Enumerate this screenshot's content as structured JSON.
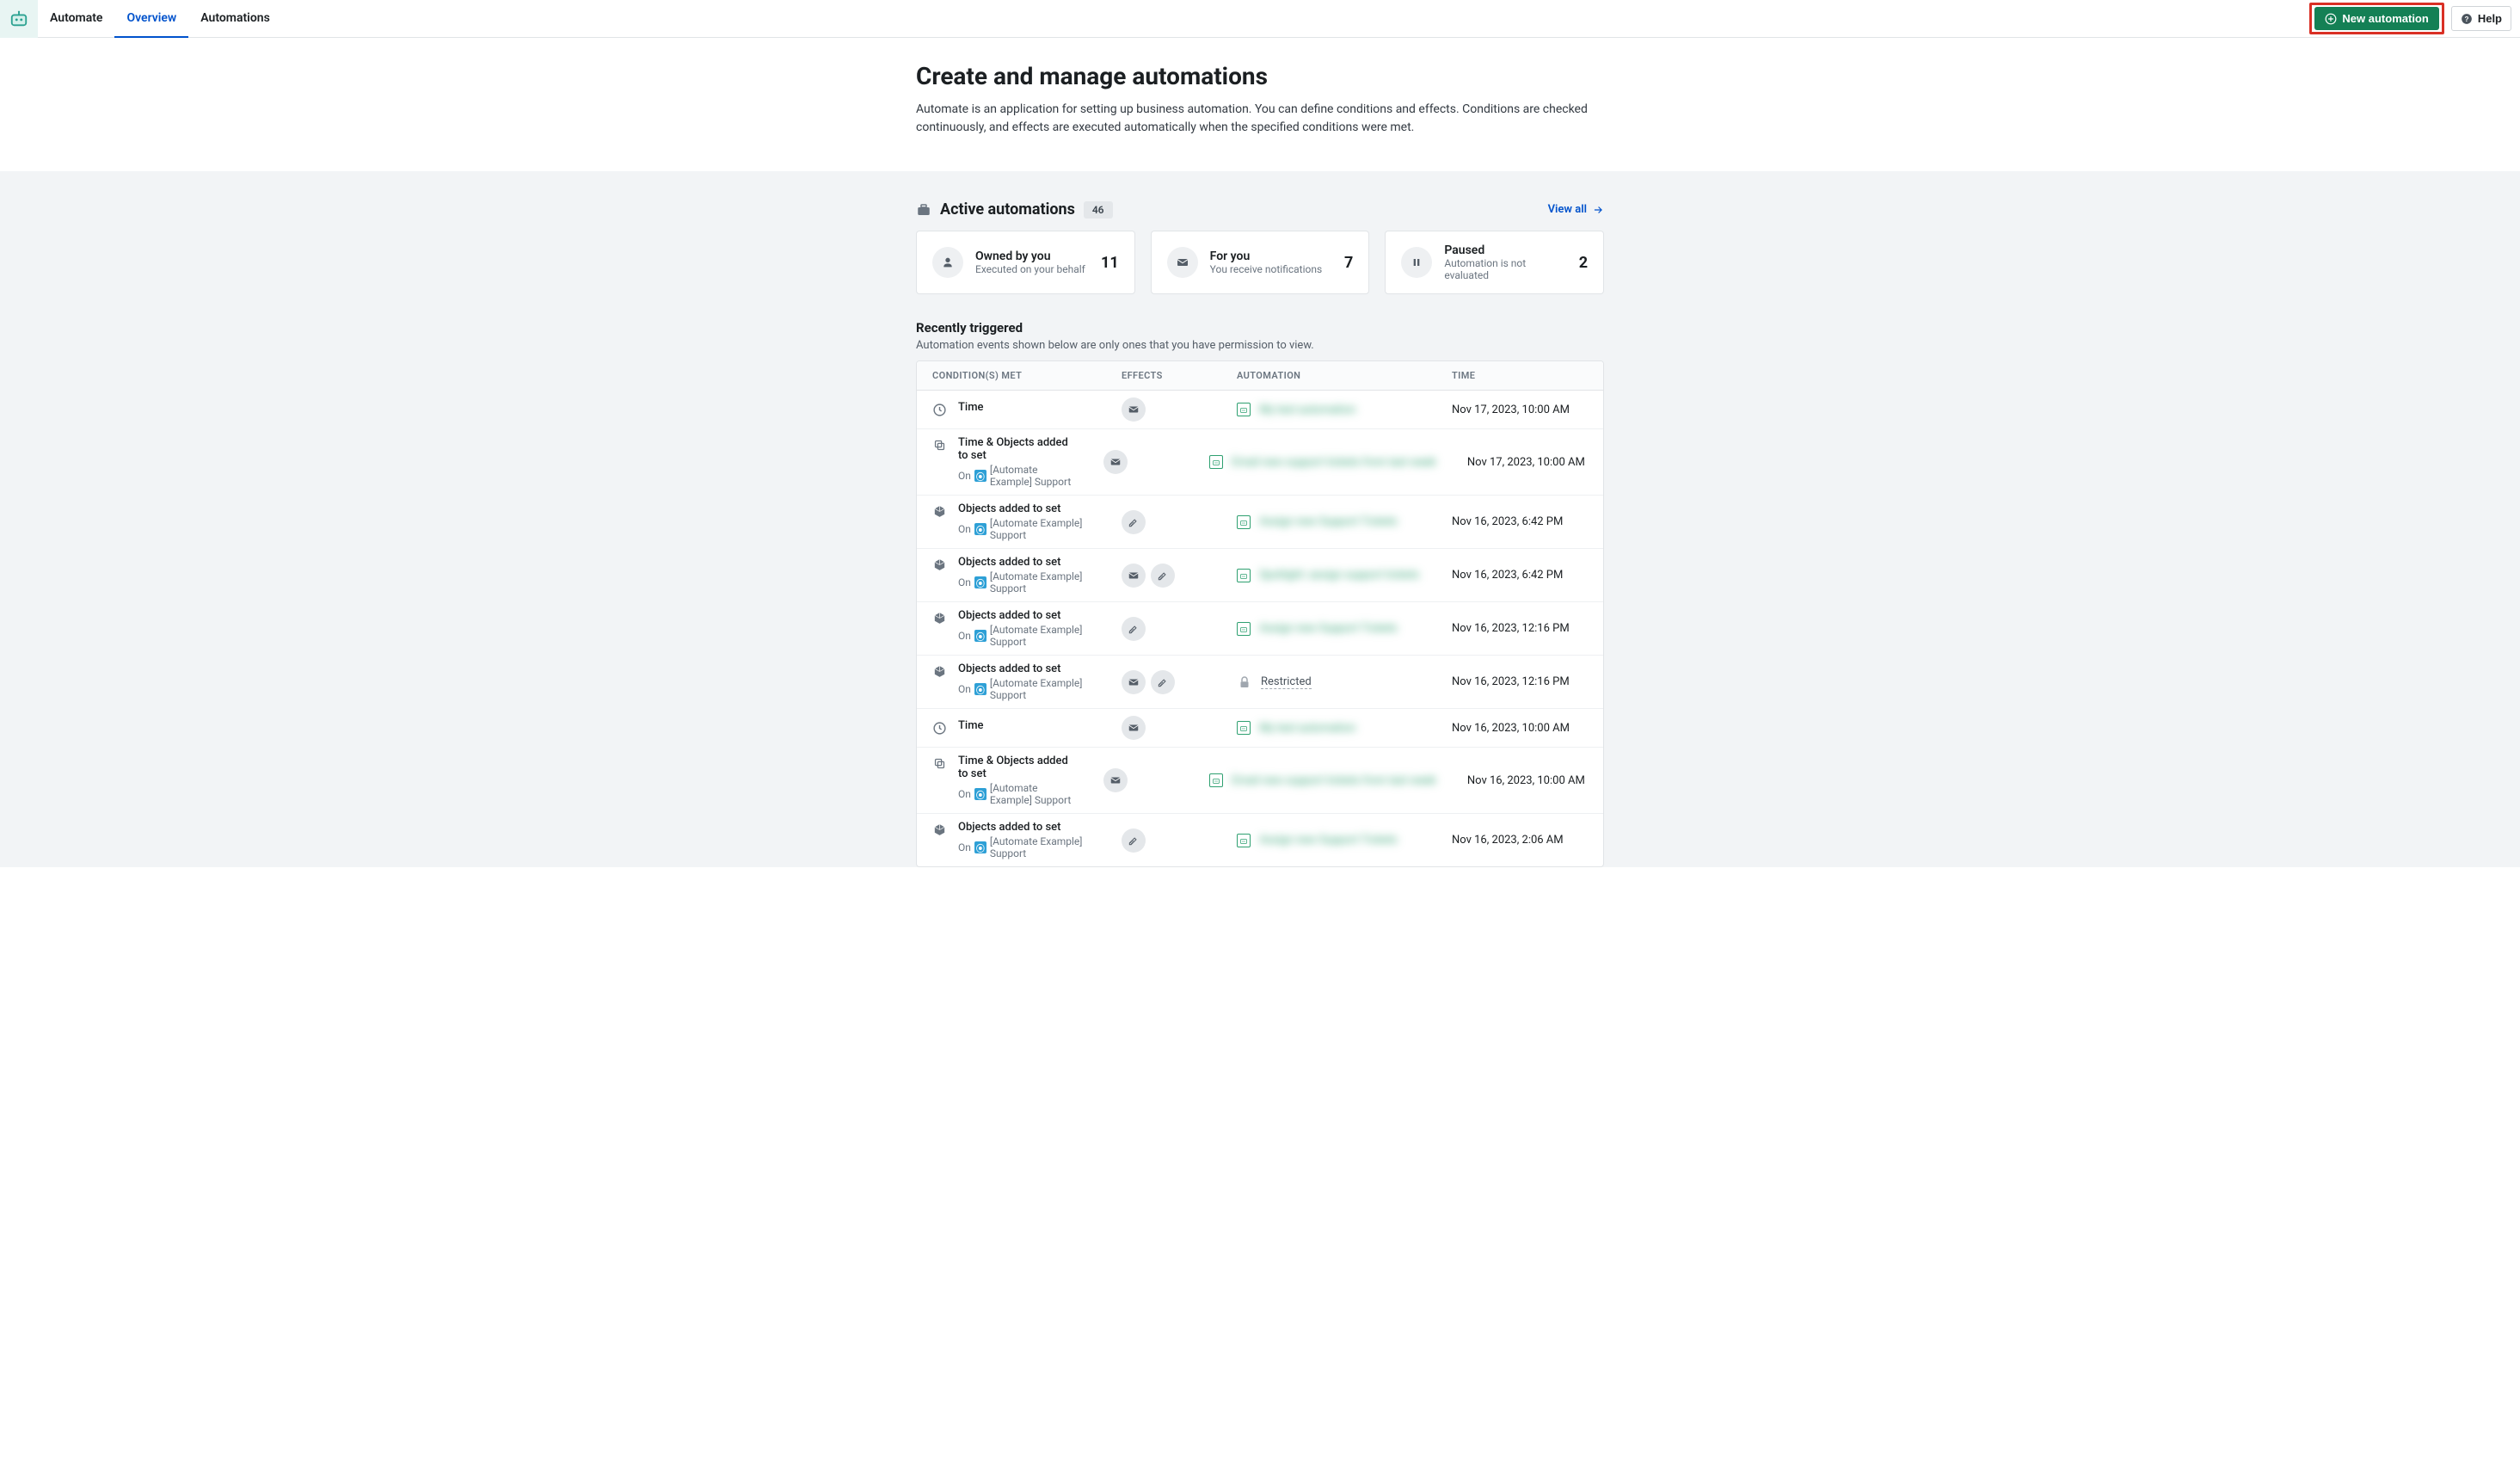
{
  "nav": {
    "app_label": "Automate",
    "overview": "Overview",
    "automations": "Automations",
    "new_automation_label": "New automation",
    "help_label": "Help"
  },
  "hero": {
    "title": "Create and manage automations",
    "desc": "Automate is an application for setting up business automation. You can define conditions and effects. Conditions are checked continuously, and effects are executed automatically when the specified conditions were met."
  },
  "active": {
    "title": "Active automations",
    "count": "46",
    "view_all": "View all",
    "cards": [
      {
        "title": "Owned by you",
        "sub": "Executed on your behalf",
        "num": "11",
        "icon": "user"
      },
      {
        "title": "For you",
        "sub": "You receive notifications",
        "num": "7",
        "icon": "mail"
      },
      {
        "title": "Paused",
        "sub": "Automation is not evaluated",
        "num": "2",
        "icon": "pause"
      }
    ]
  },
  "recent": {
    "title": "Recently triggered",
    "desc": "Automation events shown below are only ones that you have permission to view.",
    "cols": {
      "cond": "CONDITION(S) MET",
      "eff": "EFFECTS",
      "auto": "AUTOMATION",
      "time": "TIME"
    },
    "on_label": "On",
    "obj_label": "[Automate Example] Support",
    "restricted_label": "Restricted",
    "rows": [
      {
        "cond_icon": "clock",
        "cond": "Time",
        "meta": false,
        "eff": [
          "mail"
        ],
        "auto_blur": "My test automation",
        "time": "Nov 17, 2023, 10:00 AM"
      },
      {
        "cond_icon": "copy",
        "cond": "Time & Objects added to set",
        "meta": true,
        "eff": [
          "mail"
        ],
        "auto_blur": "Email new support tickets from last week",
        "time": "Nov 17, 2023, 10:00 AM"
      },
      {
        "cond_icon": "cube",
        "cond": "Objects added to set",
        "meta": true,
        "eff": [
          "edit"
        ],
        "auto_blur": "Assign new Support Tickets",
        "time": "Nov 16, 2023, 6:42 PM"
      },
      {
        "cond_icon": "cube",
        "cond": "Objects added to set",
        "meta": true,
        "eff": [
          "mail",
          "edit"
        ],
        "auto_blur": "Spotlight: assign support tickets",
        "time": "Nov 16, 2023, 6:42 PM"
      },
      {
        "cond_icon": "cube",
        "cond": "Objects added to set",
        "meta": true,
        "eff": [
          "edit"
        ],
        "auto_blur": "Assign new Support Tickets",
        "time": "Nov 16, 2023, 12:16 PM"
      },
      {
        "cond_icon": "cube",
        "cond": "Objects added to set",
        "meta": true,
        "eff": [
          "mail",
          "edit"
        ],
        "restricted": true,
        "time": "Nov 16, 2023, 12:16 PM"
      },
      {
        "cond_icon": "clock",
        "cond": "Time",
        "meta": false,
        "eff": [
          "mail"
        ],
        "auto_blur": "My test automation",
        "time": "Nov 16, 2023, 10:00 AM"
      },
      {
        "cond_icon": "copy",
        "cond": "Time & Objects added to set",
        "meta": true,
        "eff": [
          "mail"
        ],
        "auto_blur": "Email new support tickets from last week",
        "time": "Nov 16, 2023, 10:00 AM"
      },
      {
        "cond_icon": "cube",
        "cond": "Objects added to set",
        "meta": true,
        "eff": [
          "edit"
        ],
        "auto_blur": "Assign new Support Tickets",
        "time": "Nov 16, 2023, 2:06 AM"
      }
    ]
  }
}
